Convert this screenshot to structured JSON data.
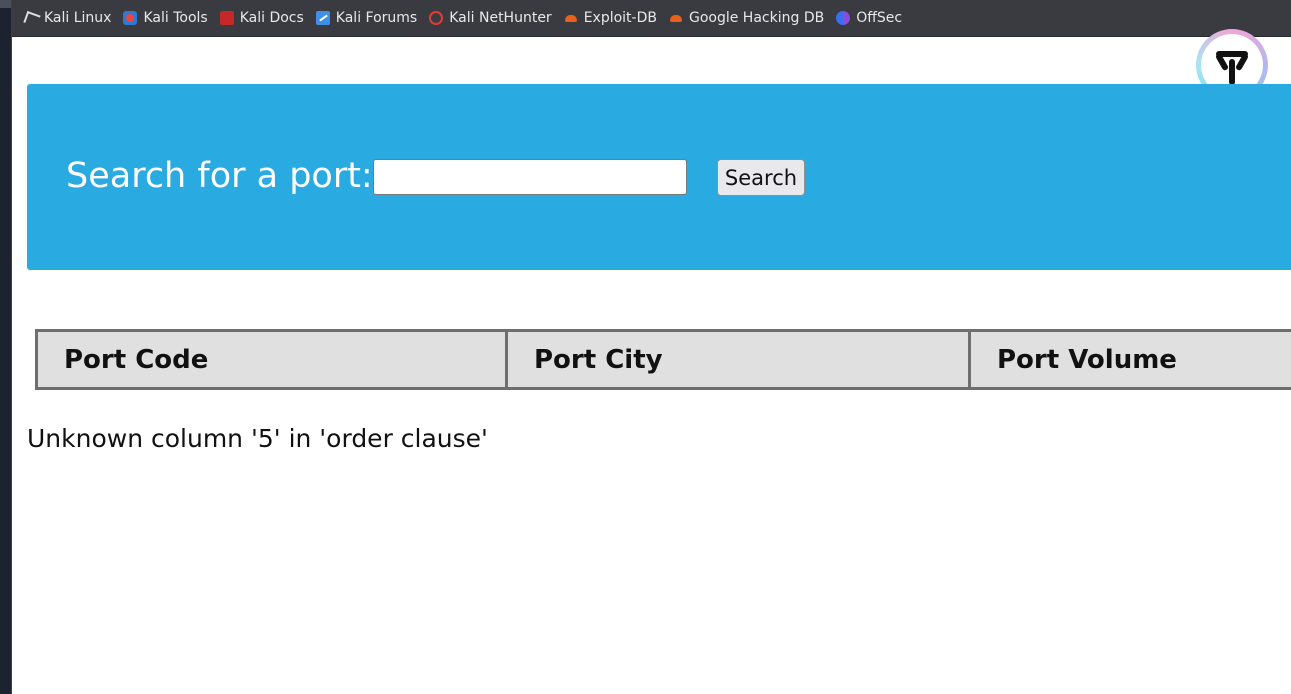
{
  "bookmarks": [
    {
      "label": "Kali Linux",
      "icon": "kali-dragon-icon"
    },
    {
      "label": "Kali Tools",
      "icon": "kali-tools-icon"
    },
    {
      "label": "Kali Docs",
      "icon": "kali-docs-icon"
    },
    {
      "label": "Kali Forums",
      "icon": "kali-forums-icon"
    },
    {
      "label": "Kali NetHunter",
      "icon": "kali-nethunter-icon"
    },
    {
      "label": "Exploit-DB",
      "icon": "exploit-db-icon"
    },
    {
      "label": "Google Hacking DB",
      "icon": "exploit-db-icon"
    },
    {
      "label": "OffSec",
      "icon": "offsec-icon"
    }
  ],
  "search": {
    "label": "Search for a port:",
    "value": "",
    "button_label": "Search"
  },
  "table": {
    "headers": [
      "Port Code",
      "Port City",
      "Port Volume"
    ]
  },
  "error_message": "Unknown column '5' in 'order clause'",
  "colors": {
    "banner": "#29abe2",
    "bookmarks_bar": "#3a3b40",
    "table_header": "#e0e0e0"
  }
}
